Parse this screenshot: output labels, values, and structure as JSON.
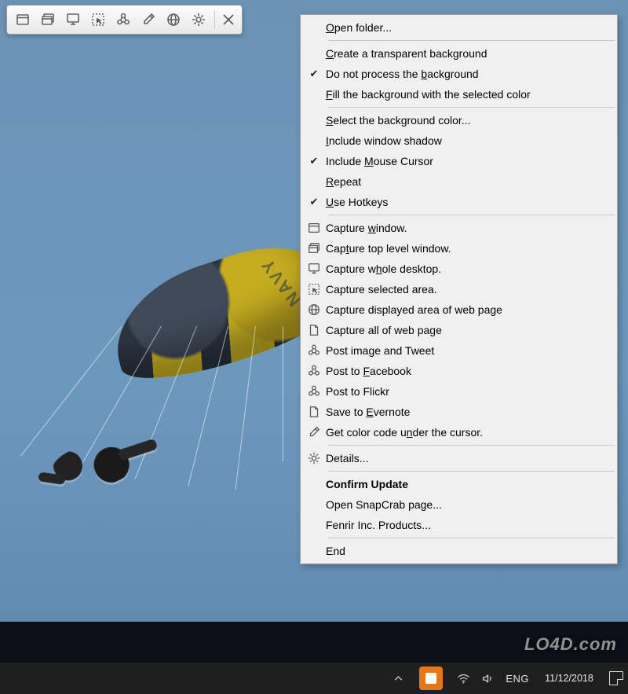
{
  "toolbar": {
    "buttons": [
      {
        "name": "capture-window-button",
        "icon": "window-icon"
      },
      {
        "name": "capture-top-window-button",
        "icon": "stacked-window-icon"
      },
      {
        "name": "capture-desktop-button",
        "icon": "monitor-icon"
      },
      {
        "name": "capture-selection-button",
        "icon": "selection-icon"
      },
      {
        "name": "post-tweet-button",
        "icon": "share-icon"
      },
      {
        "name": "color-picker-button",
        "icon": "eyedropper-icon"
      },
      {
        "name": "capture-webpage-button",
        "icon": "globe-icon"
      },
      {
        "name": "settings-button",
        "icon": "gear-icon"
      }
    ]
  },
  "menu": {
    "groups": [
      [
        {
          "name": "open-folder",
          "label": "Open folder...",
          "accel": "O"
        }
      ],
      [
        {
          "name": "create-transparent-bg",
          "label": "Create a transparent background",
          "accel": "C"
        },
        {
          "name": "no-process-bg",
          "label": "Do not process the background",
          "accel": "b",
          "checked": true
        },
        {
          "name": "fill-bg-color",
          "label": "Fill the background with the selected color",
          "accel": "F"
        }
      ],
      [
        {
          "name": "select-bg-color",
          "label": "Select the background color...",
          "accel": "S"
        },
        {
          "name": "include-shadow",
          "label": "Include window shadow",
          "accel": "I"
        },
        {
          "name": "include-mouse",
          "label": "Include Mouse Cursor",
          "accel": "M",
          "checked": true
        },
        {
          "name": "repeat",
          "label": "Repeat",
          "accel": "R"
        },
        {
          "name": "use-hotkeys",
          "label": "Use Hotkeys",
          "accel": "U",
          "checked": true
        }
      ],
      [
        {
          "name": "capture-window",
          "label": "Capture window.",
          "accel": "w",
          "icon": "window-icon"
        },
        {
          "name": "capture-top-window",
          "label": "Capture top level window.",
          "accel": "t",
          "icon": "stacked-window-icon"
        },
        {
          "name": "capture-desktop",
          "label": "Capture whole desktop.",
          "accel": "h",
          "icon": "monitor-icon"
        },
        {
          "name": "capture-selected",
          "label": "Capture selected area.",
          "icon": "selection-icon"
        },
        {
          "name": "capture-displayed-web",
          "label": "Capture displayed area of web page",
          "icon": "globe-icon"
        },
        {
          "name": "capture-all-web",
          "label": "Capture all of web page",
          "icon": "page-icon"
        },
        {
          "name": "post-tweet",
          "label": "Post image and Tweet",
          "icon": "share-icon"
        },
        {
          "name": "post-facebook",
          "label": "Post to Facebook",
          "accel": "F",
          "icon": "share-icon"
        },
        {
          "name": "post-flickr",
          "label": "Post to Flickr",
          "icon": "share-icon"
        },
        {
          "name": "save-evernote",
          "label": "Save to Evernote",
          "accel": "E",
          "icon": "page-icon"
        },
        {
          "name": "get-color",
          "label": "Get color code under the cursor.",
          "accel": "n",
          "icon": "eyedropper-icon"
        }
      ],
      [
        {
          "name": "details",
          "label": "Details...",
          "icon": "gear-icon"
        }
      ],
      [
        {
          "name": "confirm-update",
          "label": "Confirm Update",
          "bold": true
        },
        {
          "name": "open-snapcrab",
          "label": "Open SnapCrab page..."
        },
        {
          "name": "fenrir-products",
          "label": "Fenrir Inc. Products..."
        }
      ],
      [
        {
          "name": "end",
          "label": "End"
        }
      ]
    ]
  },
  "taskbar": {
    "language": "ENG",
    "date": "11/12/2018"
  },
  "watermark": "LO4D.com"
}
